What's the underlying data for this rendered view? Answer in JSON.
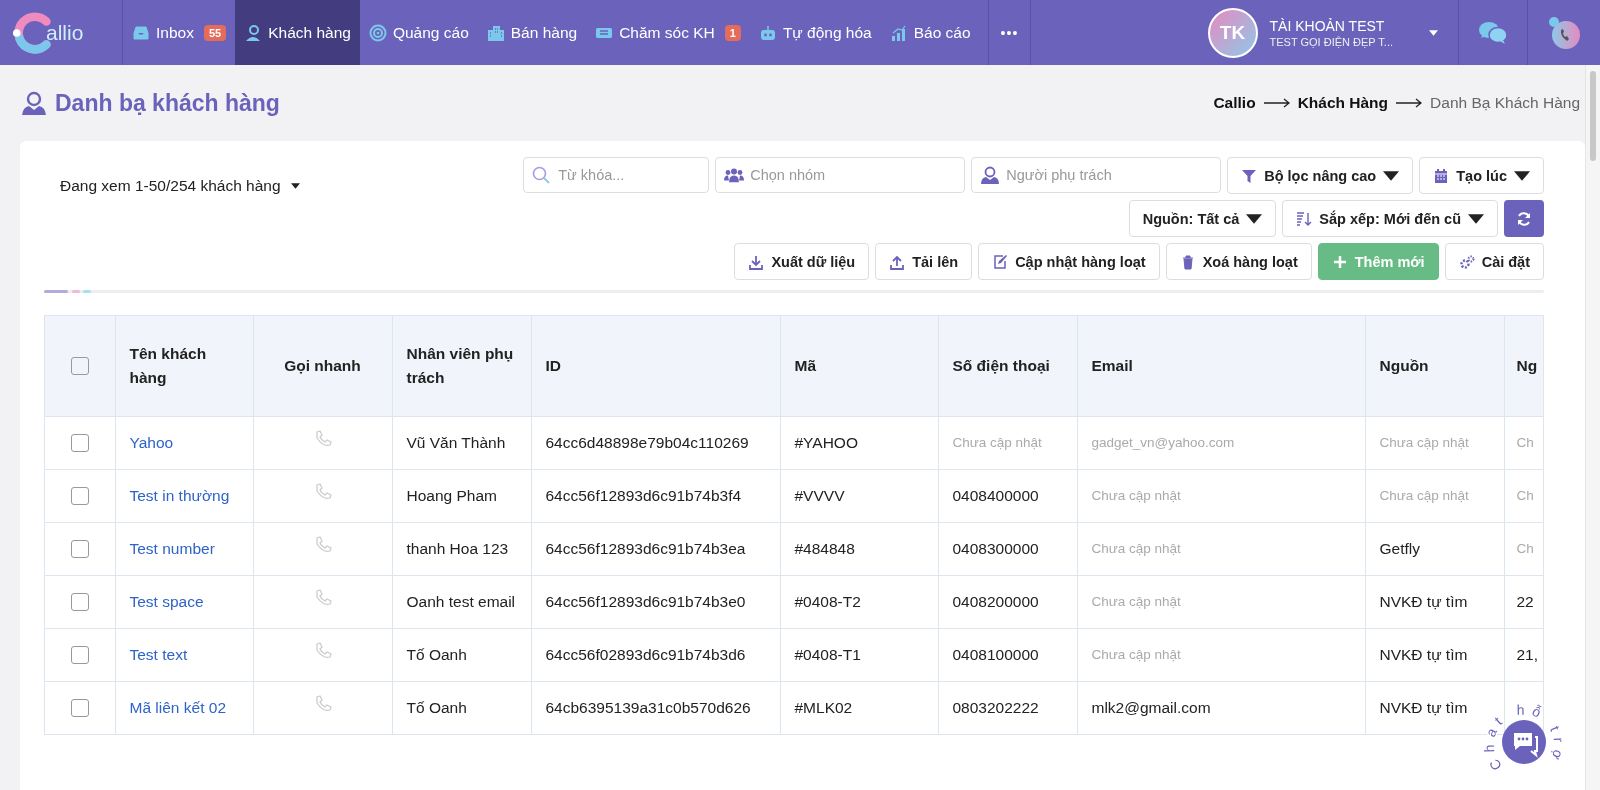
{
  "nav": {
    "logo": "allio",
    "items": [
      {
        "label": "Inbox",
        "badge": "55",
        "selected": false
      },
      {
        "label": "Khách hàng",
        "selected": true
      },
      {
        "label": "Quảng cáo",
        "selected": false
      },
      {
        "label": "Bán hàng",
        "selected": false
      },
      {
        "label": "Chăm sóc KH",
        "badge": "1",
        "selected": false
      },
      {
        "label": "Tự động hóa",
        "selected": false
      },
      {
        "label": "Báo cáo",
        "selected": false
      }
    ],
    "more": "•••",
    "user": {
      "initials": "TK",
      "name": "TÀI KHOẢN TEST",
      "subtitle": "TEST GỌI ĐIỆN ĐẸP T..."
    }
  },
  "page": {
    "title": "Danh bạ khách hàng",
    "breadcrumb": [
      {
        "label": "Callio",
        "current": false
      },
      {
        "label": "Khách Hàng",
        "current": false
      },
      {
        "label": "Danh Bạ Khách Hàng",
        "current": true
      }
    ]
  },
  "toolbar": {
    "viewing": "Đang xem 1-50/254 khách hàng",
    "search": {
      "placeholder": "Từ khóa..."
    },
    "group": {
      "placeholder": "Chọn nhóm"
    },
    "owner": {
      "placeholder": "Người phụ trách"
    },
    "filters": [
      {
        "label": "Bộ lọc nâng cao"
      },
      {
        "label": "Tạo lúc"
      }
    ],
    "sorts": [
      {
        "label": "Nguồn: Tất cả"
      },
      {
        "label": "Sắp xếp: Mới đến cũ"
      }
    ],
    "actions": [
      {
        "label": "Xuất dữ liệu",
        "kind": "default"
      },
      {
        "label": "Tải lên",
        "kind": "default"
      },
      {
        "label": "Cập nhật hàng loạt",
        "kind": "default"
      },
      {
        "label": "Xoá hàng loạt",
        "kind": "default"
      },
      {
        "label": "Thêm mới",
        "kind": "success"
      },
      {
        "label": "Cài đặt",
        "kind": "default"
      }
    ]
  },
  "table": {
    "all_checked": false,
    "columns": [
      "Tên khách hàng",
      "Gọi nhanh",
      "Nhân viên phụ trách",
      "ID",
      "Mã",
      "Số điện thoại",
      "Email",
      "Nguồn",
      "Ng"
    ],
    "rows": [
      {
        "checked": false,
        "cells": [
          {
            "text": "Yahoo",
            "kind": "link"
          },
          {
            "kind": "call"
          },
          {
            "text": "Vũ Văn Thành",
            "muted": false
          },
          {
            "text": "64cc6d48898e79b04c110269",
            "muted": false
          },
          {
            "text": "#YAHOO",
            "muted": false
          },
          {
            "text": "Chưa cập nhật",
            "muted": true
          },
          {
            "text": "gadget_vn@yahoo.com",
            "muted": true
          },
          {
            "text": "Chưa cập nhật",
            "muted": true
          },
          {
            "text": "Ch",
            "muted": true
          }
        ]
      },
      {
        "checked": false,
        "cells": [
          {
            "text": "Test in thường",
            "kind": "link"
          },
          {
            "kind": "call"
          },
          {
            "text": "Hoang Pham",
            "muted": false
          },
          {
            "text": "64cc56f12893d6c91b74b3f4",
            "muted": false
          },
          {
            "text": "#VVVV",
            "muted": false
          },
          {
            "text": "0408400000",
            "muted": false
          },
          {
            "text": "Chưa cập nhật",
            "muted": true
          },
          {
            "text": "Chưa cập nhật",
            "muted": true
          },
          {
            "text": "Ch",
            "muted": true
          }
        ]
      },
      {
        "checked": false,
        "cells": [
          {
            "text": "Test number",
            "kind": "link"
          },
          {
            "kind": "call"
          },
          {
            "text": "thanh Hoa 123",
            "muted": false
          },
          {
            "text": "64cc56f12893d6c91b74b3ea",
            "muted": false
          },
          {
            "text": "#484848",
            "muted": false
          },
          {
            "text": "0408300000",
            "muted": false
          },
          {
            "text": "Chưa cập nhật",
            "muted": true
          },
          {
            "text": "Getfly",
            "muted": false
          },
          {
            "text": "Ch",
            "muted": true
          }
        ]
      },
      {
        "checked": false,
        "cells": [
          {
            "text": "Test space",
            "kind": "link"
          },
          {
            "kind": "call"
          },
          {
            "text": "Oanh test email",
            "muted": false
          },
          {
            "text": "64cc56f12893d6c91b74b3e0",
            "muted": false
          },
          {
            "text": "#0408-T2",
            "muted": false
          },
          {
            "text": "0408200000",
            "muted": false
          },
          {
            "text": "Chưa cập nhật",
            "muted": true
          },
          {
            "text": "NVKĐ tự tìm",
            "muted": false
          },
          {
            "text": "22",
            "muted": false
          }
        ]
      },
      {
        "checked": false,
        "cells": [
          {
            "text": "Test text",
            "kind": "link"
          },
          {
            "kind": "call"
          },
          {
            "text": "Tố Oanh",
            "muted": false
          },
          {
            "text": "64cc56f02893d6c91b74b3d6",
            "muted": false
          },
          {
            "text": "#0408-T1",
            "muted": false
          },
          {
            "text": "0408100000",
            "muted": false
          },
          {
            "text": "Chưa cập nhật",
            "muted": true
          },
          {
            "text": "NVKĐ tự tìm",
            "muted": false
          },
          {
            "text": "21,",
            "muted": false
          }
        ]
      },
      {
        "checked": false,
        "cells": [
          {
            "text": "Mã liên kết 02",
            "kind": "link"
          },
          {
            "kind": "call"
          },
          {
            "text": "Tố Oanh",
            "muted": false
          },
          {
            "text": "64cb6395139a31c0b570d626",
            "muted": false
          },
          {
            "text": "#MLK02",
            "muted": false
          },
          {
            "text": "0803202222",
            "muted": false
          },
          {
            "text": "mlk2@gmail.com",
            "muted": false
          },
          {
            "text": "NVKĐ tự tìm",
            "muted": false
          }
        ]
      }
    ]
  },
  "chat_widget": {
    "label": "Chat hỗ trợ"
  }
}
